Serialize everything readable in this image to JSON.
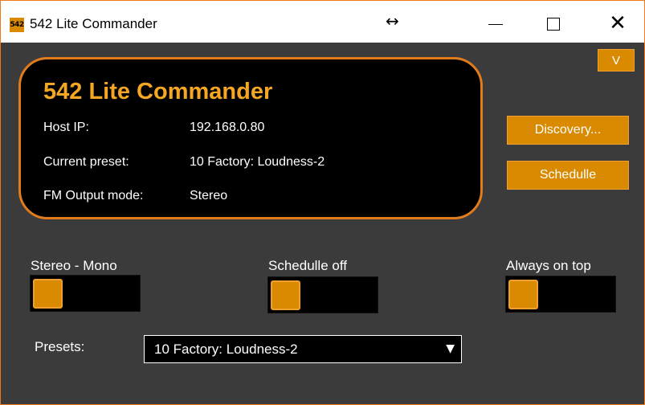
{
  "window": {
    "title": "542 Lite Commander",
    "icon_text": "542",
    "icons": {
      "resize": "↔",
      "minimize": "minimize-icon",
      "maximize": "maximize-icon",
      "close": "✕"
    }
  },
  "colors": {
    "accent": "#d98a00",
    "title_orange": "#f5a623",
    "panel_border": "#e07c1c",
    "background": "#3b3b3b"
  },
  "info_panel": {
    "title": "542 Lite Commander",
    "rows": [
      {
        "label": "Host IP:",
        "value": "192.168.0.80"
      },
      {
        "label": "Current preset:",
        "value": "10 Factory: Loudness-2"
      },
      {
        "label": "FM Output mode:",
        "value": "Stereo"
      }
    ]
  },
  "buttons": {
    "v": "V",
    "discovery": "Discovery...",
    "schedule": "Schedulle"
  },
  "toggles": [
    {
      "label": "Stereo - Mono",
      "on": false
    },
    {
      "label": "Schedulle off",
      "on": false
    },
    {
      "label": "Always on top",
      "on": false
    }
  ],
  "presets": {
    "label": "Presets:",
    "selected": "10 Factory: Loudness-2",
    "arrow": "▼"
  }
}
